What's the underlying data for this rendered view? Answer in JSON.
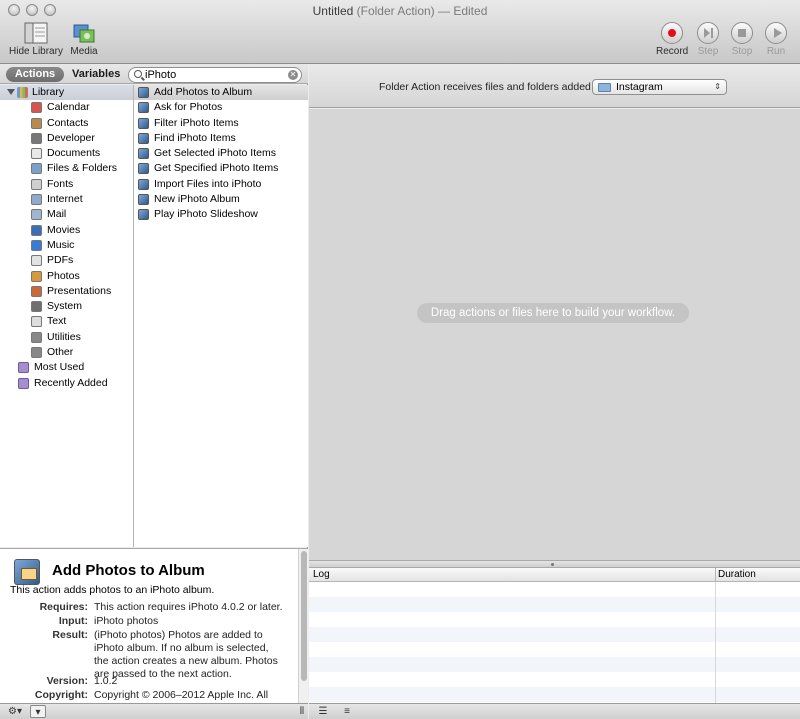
{
  "window": {
    "title": "Untitled",
    "title_suffix": "(Folder Action) — Edited"
  },
  "toolbar": {
    "hide_library": "Hide Library",
    "media": "Media",
    "record": "Record",
    "step": "Step",
    "stop": "Stop",
    "run": "Run"
  },
  "library_pane": {
    "tab_actions": "Actions",
    "tab_variables": "Variables",
    "search_value": "iPhoto",
    "library_root": "Library",
    "categories": [
      {
        "label": "Calendar",
        "icon": "calendar-icon",
        "color": "#d9534f"
      },
      {
        "label": "Contacts",
        "icon": "contacts-icon",
        "color": "#b98a4e"
      },
      {
        "label": "Developer",
        "icon": "developer-icon",
        "color": "#777777"
      },
      {
        "label": "Documents",
        "icon": "documents-icon",
        "color": "#e8e8e8"
      },
      {
        "label": "Files & Folders",
        "icon": "files-icon",
        "color": "#7da0c8"
      },
      {
        "label": "Fonts",
        "icon": "fonts-icon",
        "color": "#cfcfcf"
      },
      {
        "label": "Internet",
        "icon": "internet-icon",
        "color": "#8faacc"
      },
      {
        "label": "Mail",
        "icon": "mail-icon",
        "color": "#9fb6d1"
      },
      {
        "label": "Movies",
        "icon": "movies-icon",
        "color": "#3b6fb5"
      },
      {
        "label": "Music",
        "icon": "music-icon",
        "color": "#3a7bd5"
      },
      {
        "label": "PDFs",
        "icon": "pdf-icon",
        "color": "#e2e2e2"
      },
      {
        "label": "Photos",
        "icon": "photos-icon",
        "color": "#d79a3a"
      },
      {
        "label": "Presentations",
        "icon": "presentations-icon",
        "color": "#c86a3a"
      },
      {
        "label": "System",
        "icon": "system-icon",
        "color": "#6f6f6f"
      },
      {
        "label": "Text",
        "icon": "text-icon",
        "color": "#dcdcdc"
      },
      {
        "label": "Utilities",
        "icon": "utilities-icon",
        "color": "#888888"
      },
      {
        "label": "Other",
        "icon": "other-icon",
        "color": "#888888"
      }
    ],
    "smart_groups": [
      {
        "label": "Most Used",
        "icon": "smart-folder-icon",
        "color": "#a58fcf"
      },
      {
        "label": "Recently Added",
        "icon": "smart-folder-icon",
        "color": "#a58fcf"
      }
    ],
    "actions": [
      "Add Photos to Album",
      "Ask for Photos",
      "Filter iPhoto Items",
      "Find iPhoto Items",
      "Get Selected iPhoto Items",
      "Get Specified iPhoto Items",
      "Import Files into iPhoto",
      "New iPhoto Album",
      "Play iPhoto Slideshow"
    ]
  },
  "description": {
    "title": "Add Photos to Album",
    "summary": "This action adds photos to an iPhoto album.",
    "requires_label": "Requires:",
    "requires_value": "This action requires iPhoto 4.0.2 or later.",
    "input_label": "Input:",
    "input_value": "iPhoto photos",
    "result_label": "Result:",
    "result_value": "(iPhoto photos) Photos are added to iPhoto album. If no album is selected, the action creates a new album. Photos are passed to the next action.",
    "version_label": "Version:",
    "version_value": "1.0.2",
    "copyright_label": "Copyright:",
    "copyright_value": "Copyright © 2006–2012 Apple Inc. All"
  },
  "workflow": {
    "receives_label": "Folder Action receives files and folders added to",
    "folder_value": "Instagram",
    "hint": "Drag actions or files here to build your workflow."
  },
  "log": {
    "col_log": "Log",
    "col_duration": "Duration"
  }
}
